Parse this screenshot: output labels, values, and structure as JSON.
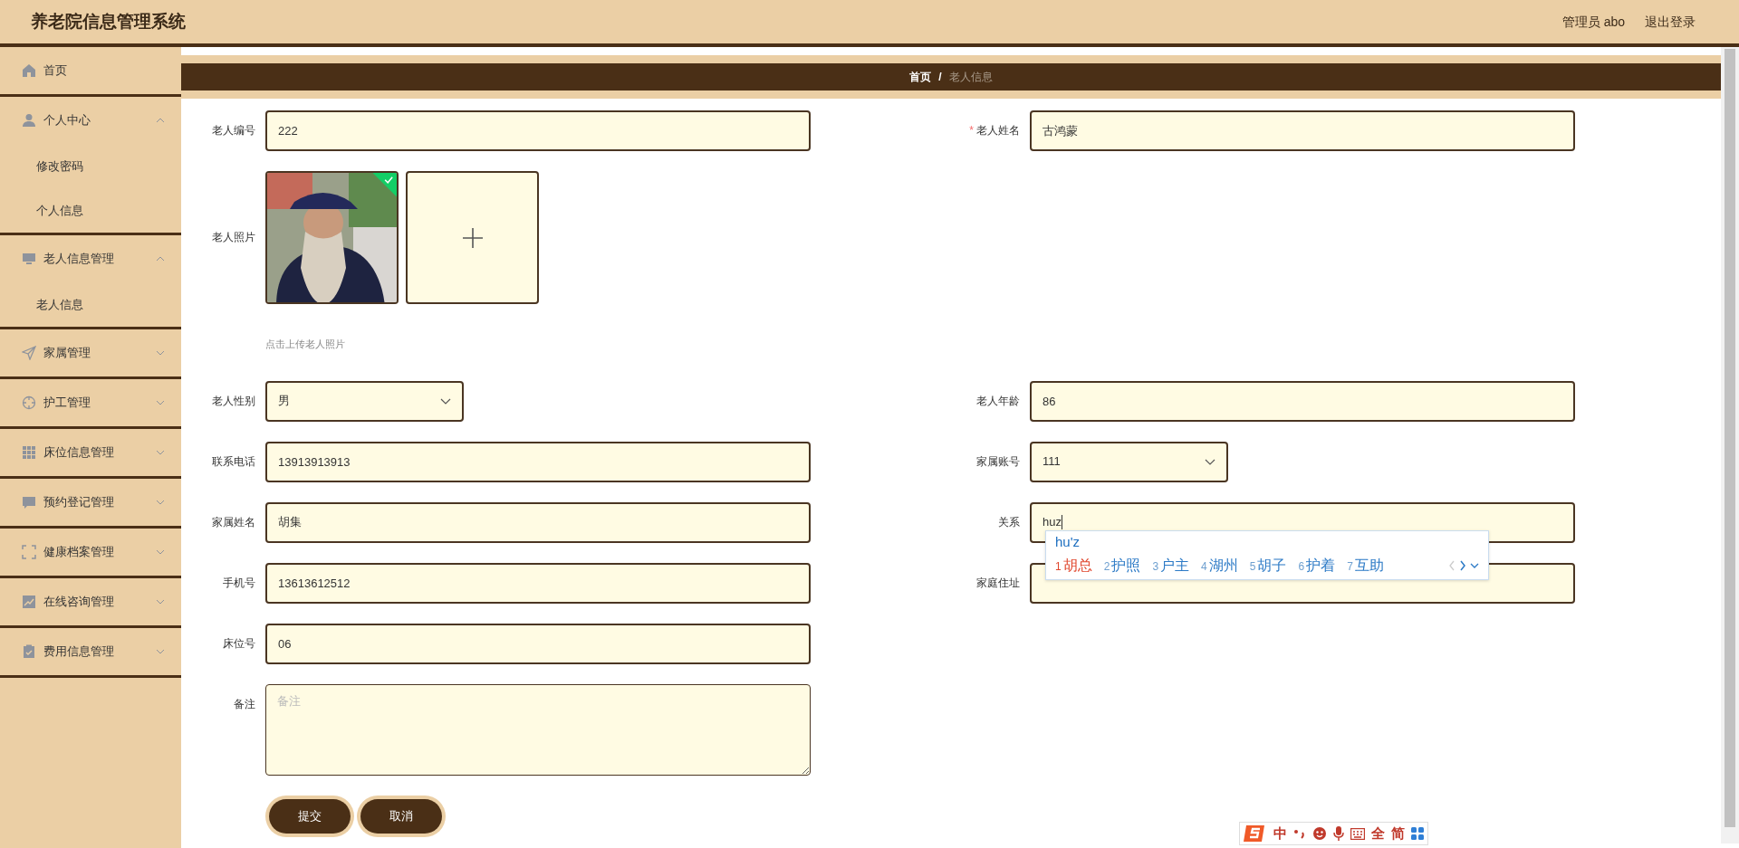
{
  "header": {
    "title": "养老院信息管理系统",
    "user": "管理员 abo",
    "logout": "退出登录"
  },
  "sidebar": {
    "items": [
      {
        "label": "首页",
        "kind": "link"
      },
      {
        "label": "个人中心",
        "kind": "group",
        "expanded": true,
        "children": [
          {
            "label": "修改密码"
          },
          {
            "label": "个人信息"
          }
        ]
      },
      {
        "label": "老人信息管理",
        "kind": "group",
        "expanded": true,
        "children": [
          {
            "label": "老人信息"
          }
        ]
      },
      {
        "label": "家属管理",
        "kind": "group",
        "expanded": false
      },
      {
        "label": "护工管理",
        "kind": "group",
        "expanded": false
      },
      {
        "label": "床位信息管理",
        "kind": "group",
        "expanded": false
      },
      {
        "label": "预约登记管理",
        "kind": "group",
        "expanded": false
      },
      {
        "label": "健康档案管理",
        "kind": "group",
        "expanded": false
      },
      {
        "label": "在线咨询管理",
        "kind": "group",
        "expanded": false
      },
      {
        "label": "费用信息管理",
        "kind": "group",
        "expanded": false
      }
    ]
  },
  "breadcrumb_separator": "/",
  "breadcrumb": [
    {
      "label": "首页",
      "current": false
    },
    {
      "label": "老人信息",
      "current": true
    }
  ],
  "form": {
    "rows": [
      {
        "left": {
          "label": "老人编号",
          "kind": "text",
          "value": "222"
        },
        "right": {
          "label": "老人姓名",
          "kind": "text",
          "value": "古鸿蒙",
          "required_marker": "*"
        }
      },
      {
        "left": {
          "label": "老人照片",
          "uploaded": true,
          "hint": "点击上传老人照片"
        }
      },
      {
        "left": {
          "label": "老人性别",
          "kind": "select",
          "value": "男"
        },
        "right": {
          "label": "老人年龄",
          "kind": "text",
          "value": "86"
        }
      },
      {
        "left": {
          "label": "联系电话",
          "kind": "text",
          "value": "13913913913"
        },
        "right": {
          "label": "家属账号",
          "kind": "select",
          "value": "111"
        }
      },
      {
        "left": {
          "label": "家属姓名",
          "kind": "text",
          "value": "胡集"
        },
        "right": {
          "label": "关系",
          "kind": "text",
          "value": "huz",
          "focused": true
        }
      },
      {
        "left": {
          "label": "手机号",
          "kind": "text",
          "value": "13613612512"
        },
        "right": {
          "label": "家庭住址",
          "kind": "text"
        }
      },
      {
        "left": {
          "label": "床位号",
          "kind": "text",
          "value": "06"
        }
      },
      {
        "left": {
          "label": "备注",
          "kind": "textarea",
          "placeholder": "备注"
        }
      }
    ],
    "buttons": [
      "提交",
      "取消"
    ]
  },
  "ime": {
    "composition": "hu'z",
    "candidates": [
      {
        "number": "1",
        "text": "胡总",
        "selected": true
      },
      {
        "number": "2",
        "text": "护照",
        "selected": false
      },
      {
        "number": "3",
        "text": "户主",
        "selected": false
      },
      {
        "number": "4",
        "text": "湖州",
        "selected": false
      },
      {
        "number": "5",
        "text": "胡子",
        "selected": false
      },
      {
        "number": "6",
        "text": "护着",
        "selected": false
      },
      {
        "number": "7",
        "text": "互助",
        "selected": false
      }
    ],
    "toolbar": [
      {
        "kind": "logo"
      },
      {
        "kind": "text",
        "text": "中"
      },
      {
        "kind": "punct"
      },
      {
        "kind": "emoji"
      },
      {
        "kind": "mic"
      },
      {
        "kind": "keyboard"
      },
      {
        "kind": "text",
        "text": "全"
      },
      {
        "kind": "text",
        "text": "简"
      },
      {
        "kind": "apps"
      }
    ]
  }
}
